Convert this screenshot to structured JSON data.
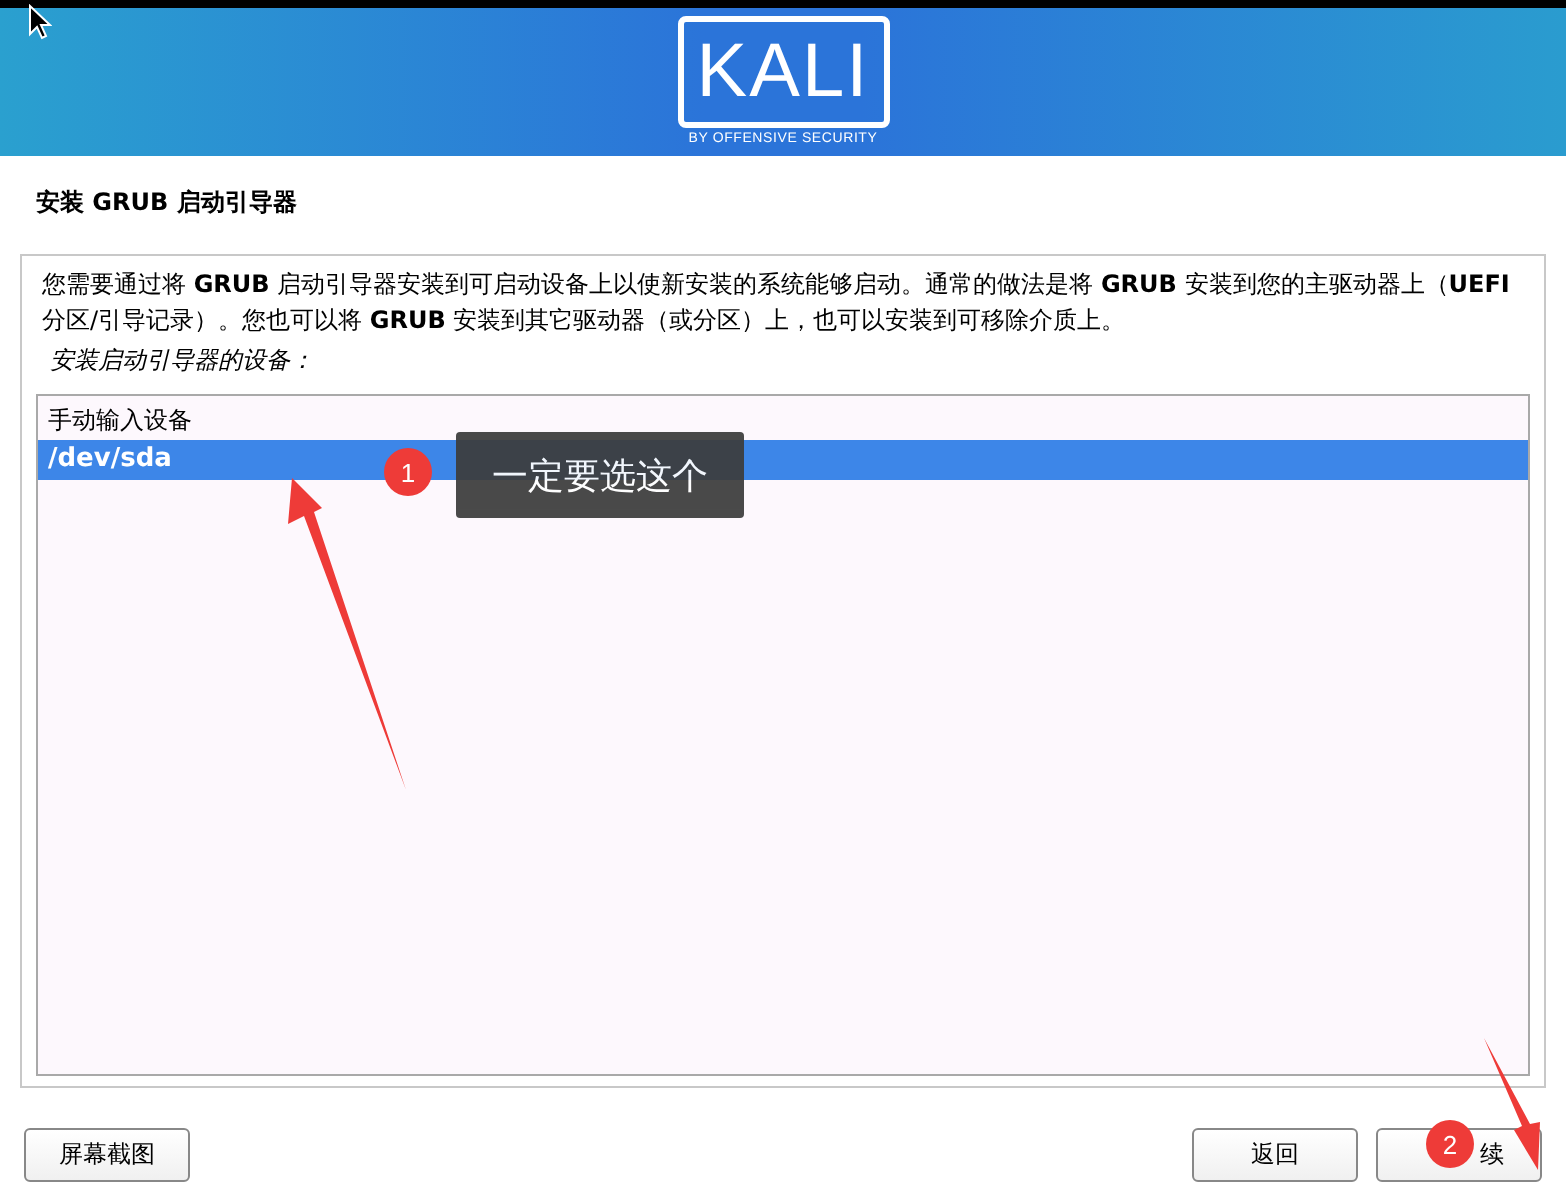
{
  "banner": {
    "logo": "KALI",
    "tagline": "BY OFFENSIVE SECURITY"
  },
  "page_title": "安装 GRUB 启动引导器",
  "description": "您需要通过将 **GRUB** 启动引导器安装到可启动设备上以使新安装的系统能够启动。通常的做法是将 **GRUB** 安装到您的主驱动器上（**UEFI** 分区/引导记录）。您也可以将 **GRUB** 安装到其它驱动器（或分区）上，也可以安装到可移除介质上。",
  "device_label": "安装启动引导器的设备：",
  "devices": [
    {
      "label": "手动输入设备",
      "selected": false
    },
    {
      "label": "/dev/sda",
      "selected": true
    }
  ],
  "buttons": [
    {
      "label": "屏幕截图",
      "kind": "left"
    },
    {
      "label": "返回",
      "kind": "right"
    },
    {
      "label": "续",
      "kind": "right"
    }
  ],
  "annotations": [
    {
      "badge": "1",
      "callout": "一定要选这个"
    },
    {
      "badge": "2"
    }
  ]
}
